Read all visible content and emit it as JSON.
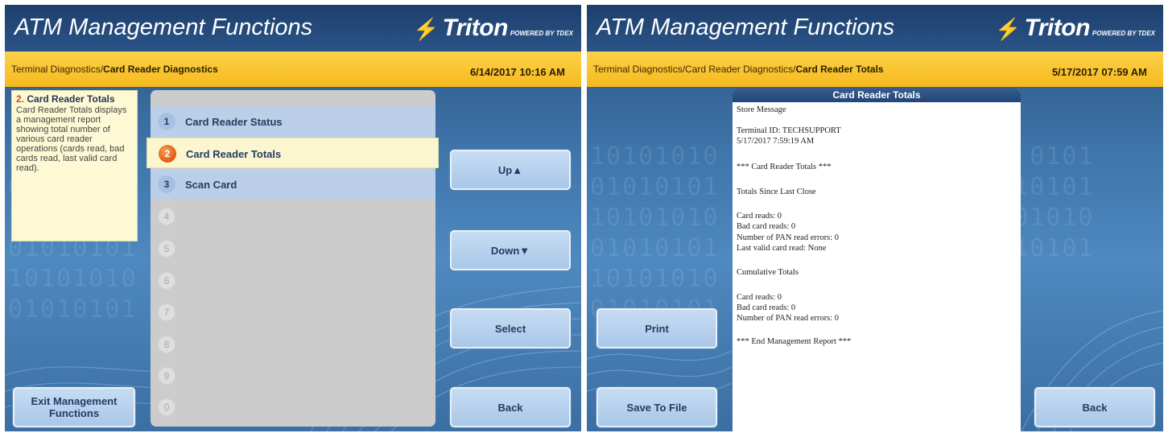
{
  "left_screen": {
    "title": "ATM Management Functions",
    "logo": {
      "brand": "Triton",
      "tagline": "POWERED BY TDEX"
    },
    "breadcrumb": {
      "path": "Terminal Diagnostics/",
      "current": "Card Reader Diagnostics"
    },
    "datetime": "6/14/2017  10:16 AM",
    "help": {
      "number": "2.",
      "title": "Card Reader Totals",
      "text": "Card Reader Totals displays a management report showing total number of various card reader operations (cards read, bad cards read, last valid card read)."
    },
    "menu": [
      {
        "num": "1",
        "label": "Card Reader Status",
        "state": "enabled"
      },
      {
        "num": "2",
        "label": "Card Reader Totals",
        "state": "selected"
      },
      {
        "num": "3",
        "label": "Scan Card",
        "state": "enabled"
      },
      {
        "num": "4",
        "label": "",
        "state": "disabled"
      },
      {
        "num": "5",
        "label": "",
        "state": "disabled"
      },
      {
        "num": "6",
        "label": "",
        "state": "disabled"
      },
      {
        "num": "7",
        "label": "",
        "state": "disabled"
      },
      {
        "num": "8",
        "label": "",
        "state": "disabled"
      },
      {
        "num": "9",
        "label": "",
        "state": "disabled"
      },
      {
        "num": "0",
        "label": "",
        "state": "disabled"
      }
    ],
    "buttons": {
      "up": "Up▲",
      "down": "Down▼",
      "select": "Select",
      "back": "Back",
      "exit": "Exit Management Functions"
    }
  },
  "right_screen": {
    "title": "ATM Management Functions",
    "logo": {
      "brand": "Triton",
      "tagline": "POWERED BY TDEX"
    },
    "breadcrumb": {
      "path": "Terminal Diagnostics/Card Reader Diagnostics/",
      "current": "Card Reader Totals"
    },
    "datetime": "5/17/2017  07:59 AM",
    "report": {
      "title": "Card Reader Totals",
      "lines": [
        "Store Message",
        "",
        "Terminal ID: TECHSUPPORT",
        "5/17/2017 7:59:19 AM",
        "",
        "*** Card Reader Totals ***",
        "",
        "Totals Since Last Close",
        "",
        "Card reads: 0",
        "Bad card reads: 0",
        "Number of PAN read errors: 0",
        "Last valid card read: None",
        "",
        "Cumulative Totals",
        "",
        "Card reads: 0",
        "Bad card reads: 0",
        "Number of PAN read errors: 0",
        "",
        "*** End Management Report ***"
      ]
    },
    "buttons": {
      "print": "Print",
      "save": "Save To File",
      "back": "Back"
    }
  },
  "colors": {
    "title_bar": "#1d3f6c",
    "crumb_bar": "#f6b91d",
    "button": "#b5cfec",
    "selected_row": "#fbf6cf",
    "selected_badge": "#e05a12"
  }
}
